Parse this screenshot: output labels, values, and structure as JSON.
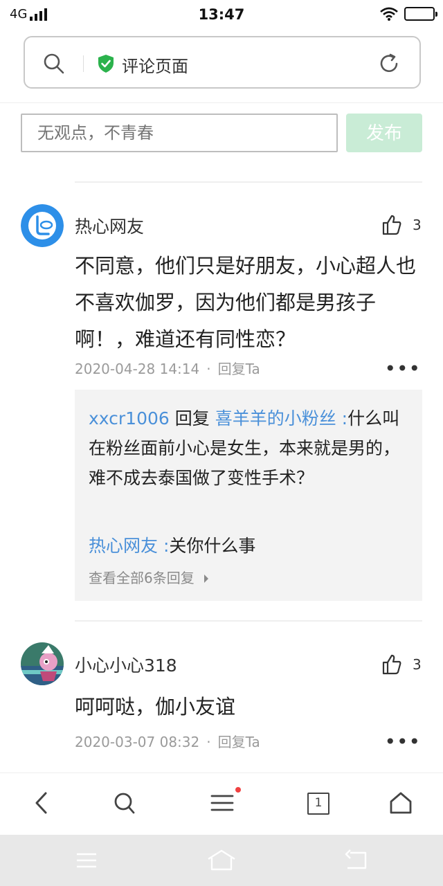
{
  "status_bar": {
    "network": "4G",
    "time": "13:47"
  },
  "address_bar": {
    "title": "评论页面",
    "icons": [
      "search-icon",
      "secure-shield-icon",
      "refresh-icon"
    ]
  },
  "comment_input": {
    "placeholder": "无观点，不青春",
    "submit_label": "发布"
  },
  "comments": [
    {
      "user": "热心网友",
      "likes": "3",
      "text": "不同意，他们只是好朋友，小心超人也不喜欢伽罗，因为他们都是男孩子啊！，难道还有同性恋？",
      "time": "2020-04-28 14:14",
      "reply_label": "回复Ta",
      "replies": {
        "first": {
          "from": "xxcr1006",
          "verb": "回复",
          "to": "喜羊羊的小粉丝 :",
          "text": "什么叫在粉丝面前小心是女生，本来就是男的，难不成去泰国做了变性手术？"
        },
        "second": {
          "from": "热心网友 :",
          "text": "关你什么事"
        },
        "view_all": "查看全部6条回复"
      }
    },
    {
      "user": "小心小心318",
      "likes": "3",
      "text": "呵呵哒，伽小友谊",
      "time": "2020-03-07 08:32",
      "reply_label": "回复Ta"
    }
  ],
  "bottom_nav": {
    "tab_count": "1",
    "items": [
      "back-icon",
      "search-icon",
      "menu-icon",
      "tabs-icon",
      "home-icon"
    ]
  },
  "colors": {
    "accent_green": "#2bb24c",
    "publish_disabled": "#c9ecd6",
    "link_blue": "#4a90d9",
    "badge_red": "#f04141"
  }
}
